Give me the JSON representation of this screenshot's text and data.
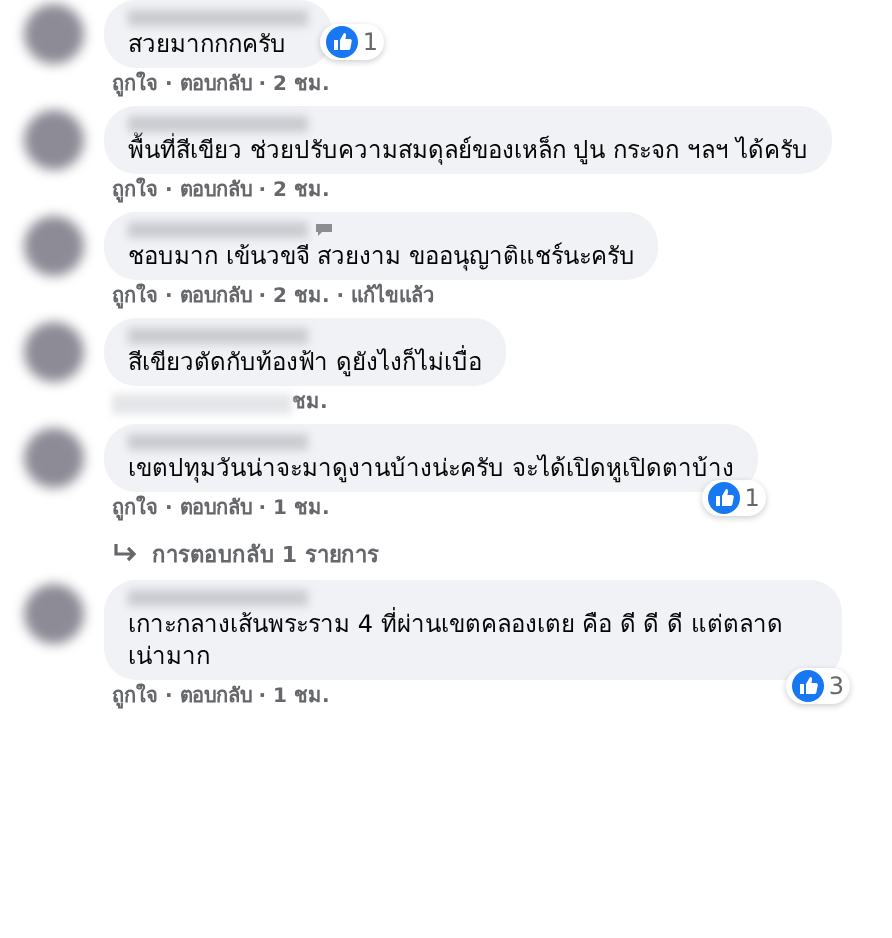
{
  "comments": [
    {
      "text": "สวยมากกกครับ",
      "reaction": {
        "count": "1"
      },
      "meta": "ถูกใจ · ตอบกลับ · 2 ชม."
    },
    {
      "text": "พื้นที่สีเขียว ช่วยปรับความสมดุลย์ของเหล็ก ปูน กระจก ฯลฯ ได้ครับ",
      "meta": "ถูกใจ · ตอบกลับ · 2 ชม."
    },
    {
      "text": "ชอบมาก เข้นวขจี สวยงาม ขออนุญาติแชร์นะครับ",
      "meta": "ถูกใจ · ตอบกลับ · 2 ชม. · แก้ไขแล้ว",
      "edited_icon": true
    },
    {
      "text": "สีเขียวตัดกับท้องฟ้า ดูยังไงก็ไม่เบื่อ",
      "meta": "ชม.",
      "meta_blurred": true
    },
    {
      "text": "เขตปทุมวันน่าจะมาดูงานบ้างน่ะครับ จะได้เปิดหูเปิดตาบ้าง",
      "reaction": {
        "count": "1"
      },
      "meta": "ถูกใจ · ตอบกลับ · 1 ชม.",
      "replies_link": "การตอบกลับ 1 รายการ"
    },
    {
      "text": "เกาะกลางเส้นพระราม 4 ที่ผ่านเขตคลองเตย คือ ดี ดี ดี แต่ตลาดเน่ามาก",
      "reaction": {
        "count": "3"
      },
      "meta": "ถูกใจ · ตอบกลับ · 1 ชม."
    }
  ]
}
